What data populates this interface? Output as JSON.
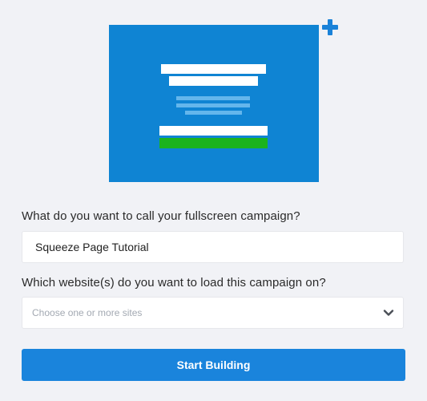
{
  "preview": {
    "icon": "fullscreen-template-preview",
    "accent_icon": "plus-icon",
    "colors": {
      "background": "#0f84d3",
      "text_bars": "#ffffff",
      "body_bars": "#64b6ec",
      "cta_bar": "#1bb31e",
      "plus": "#1a82d8"
    }
  },
  "form": {
    "name_label": "What do you want to call your fullscreen campaign?",
    "name_value": "Squeeze Page Tutorial",
    "site_label": "Which website(s) do you want to load this campaign on?",
    "site_placeholder": "Choose one or more sites",
    "site_icon": "chevron-down-icon",
    "submit_label": "Start Building",
    "submit_color": "#1a84dc"
  }
}
